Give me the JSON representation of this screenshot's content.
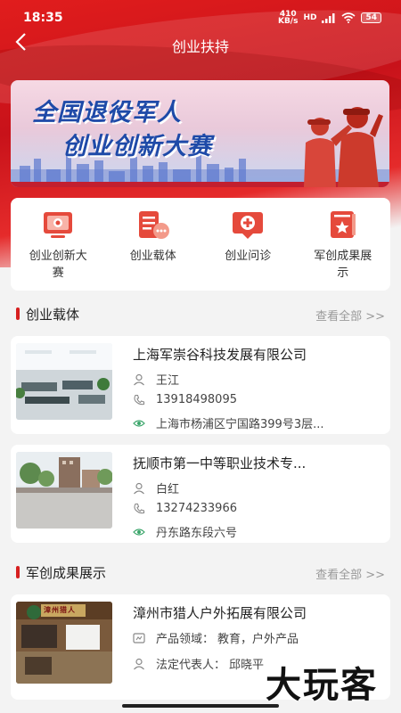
{
  "status_bar": {
    "time": "18:35",
    "net_speed_value": "410",
    "net_speed_unit": "KB/s",
    "network": "HD",
    "battery": "54"
  },
  "nav": {
    "title": "创业扶持",
    "back_icon": "chevron-left-icon"
  },
  "banner": {
    "line1": "全国退役军人",
    "line2": "创业创新大赛"
  },
  "menu": [
    {
      "label": "创业创新大赛",
      "icon": "competition-icon"
    },
    {
      "label": "创业载体",
      "icon": "carrier-icon"
    },
    {
      "label": "创业问诊",
      "icon": "consult-icon"
    },
    {
      "label": "军创成果展示",
      "icon": "achievement-icon"
    }
  ],
  "sections": {
    "carrier": {
      "title": "创业载体",
      "more": "查看全部 >>"
    },
    "achievement": {
      "title": "军创成果展示",
      "more": "查看全部 >>"
    }
  },
  "carriers": [
    {
      "name": "上海军崇谷科技发展有限公司",
      "contact": "王江",
      "phone": "13918498095",
      "address": "上海市杨浦区宁国路399号3层..."
    },
    {
      "name": "抚顺市第一中等职业技术专...",
      "contact": "白红",
      "phone": "13274233966",
      "address": "丹东路东段六号"
    }
  ],
  "achievements": [
    {
      "name": "漳州市猎人户外拓展有限公司",
      "field_label": "产品领域：",
      "field_value": "教育，户外产品",
      "rep_label": "法定代表人：",
      "rep_value": "邱晓平",
      "sign_text": "漳州猎人"
    }
  ],
  "watermark": "大玩客",
  "colors": {
    "brand_red": "#d61f1f",
    "icon_red": "#e54a3c"
  }
}
